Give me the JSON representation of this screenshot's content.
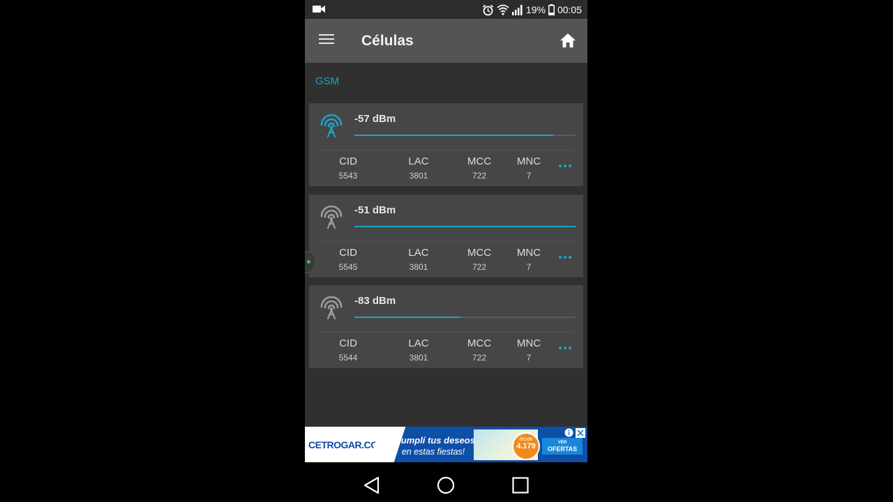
{
  "status_bar": {
    "battery_percent": "19%",
    "time": "00:05",
    "icons": [
      "video-camera-icon",
      "alarm-clock-icon",
      "wifi-icon",
      "cell-signal-icon",
      "battery-icon"
    ]
  },
  "app_bar": {
    "title": "Células",
    "menu_icon": "hamburger-menu-icon",
    "home_icon": "home-icon"
  },
  "section": {
    "label": "GSM"
  },
  "cells": [
    {
      "dbm": "-57 dBm",
      "signal_fraction": 0.9,
      "active": true,
      "columns": [
        {
          "label": "CID",
          "value": "5543"
        },
        {
          "label": "LAC",
          "value": "3801"
        },
        {
          "label": "MCC",
          "value": "722"
        },
        {
          "label": "MNC",
          "value": "7"
        }
      ]
    },
    {
      "dbm": "-51 dBm",
      "signal_fraction": 1.0,
      "active": false,
      "columns": [
        {
          "label": "CID",
          "value": "5545"
        },
        {
          "label": "LAC",
          "value": "3801"
        },
        {
          "label": "MCC",
          "value": "722"
        },
        {
          "label": "MNC",
          "value": "7"
        }
      ]
    },
    {
      "dbm": "-83 dBm",
      "signal_fraction": 0.48,
      "active": false,
      "columns": [
        {
          "label": "CID",
          "value": "5544"
        },
        {
          "label": "LAC",
          "value": "3801"
        },
        {
          "label": "MCC",
          "value": "722"
        },
        {
          "label": "MNC",
          "value": "7"
        }
      ]
    }
  ],
  "colors": {
    "accent": "#1fa3c6",
    "inactive_icon": "#9e9e9e"
  },
  "ad": {
    "brand": "CETROGAR.COM",
    "line1": "¡Cumplí tus deseos",
    "line2": "en estas fiestas!",
    "price_small": "desde",
    "price": "4.179",
    "cta_small": "VER",
    "cta": "OFERTAS"
  },
  "nav_bar": {
    "icons": [
      "back-triangle-icon",
      "home-circle-icon",
      "recents-square-icon"
    ]
  }
}
